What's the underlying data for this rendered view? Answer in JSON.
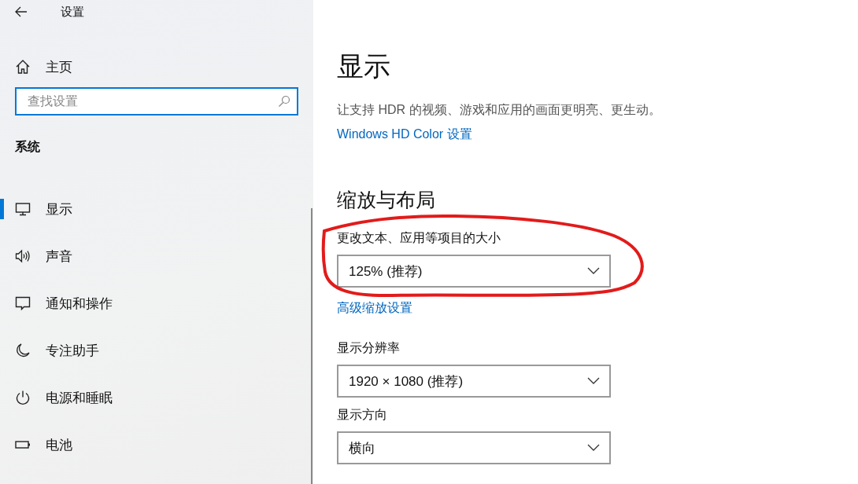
{
  "window": {
    "title": "设置"
  },
  "sidebar": {
    "home": "主页",
    "search": {
      "placeholder": "查找设置"
    },
    "section": "系统",
    "items": [
      {
        "label": "显示",
        "kind": "display",
        "selected": true
      },
      {
        "label": "声音",
        "kind": "sound",
        "selected": false
      },
      {
        "label": "通知和操作",
        "kind": "notifications",
        "selected": false
      },
      {
        "label": "专注助手",
        "kind": "focus",
        "selected": false
      },
      {
        "label": "电源和睡眠",
        "kind": "power",
        "selected": false
      },
      {
        "label": "电池",
        "kind": "battery",
        "selected": false
      }
    ]
  },
  "content": {
    "title": "显示",
    "hdr_text": "让支持 HDR 的视频、游戏和应用的画面更明亮、更生动。",
    "hdr_link": "Windows HD Color 设置",
    "section": "缩放与布局",
    "fields": [
      {
        "label": "更改文本、应用等项目的大小",
        "value": "125% (推荐)",
        "link": "高级缩放设置",
        "annotated": true
      },
      {
        "label": "显示分辨率",
        "value": "1920 × 1080 (推荐)",
        "annotated": false
      },
      {
        "label": "显示方向",
        "value": "横向",
        "annotated": false
      }
    ]
  }
}
